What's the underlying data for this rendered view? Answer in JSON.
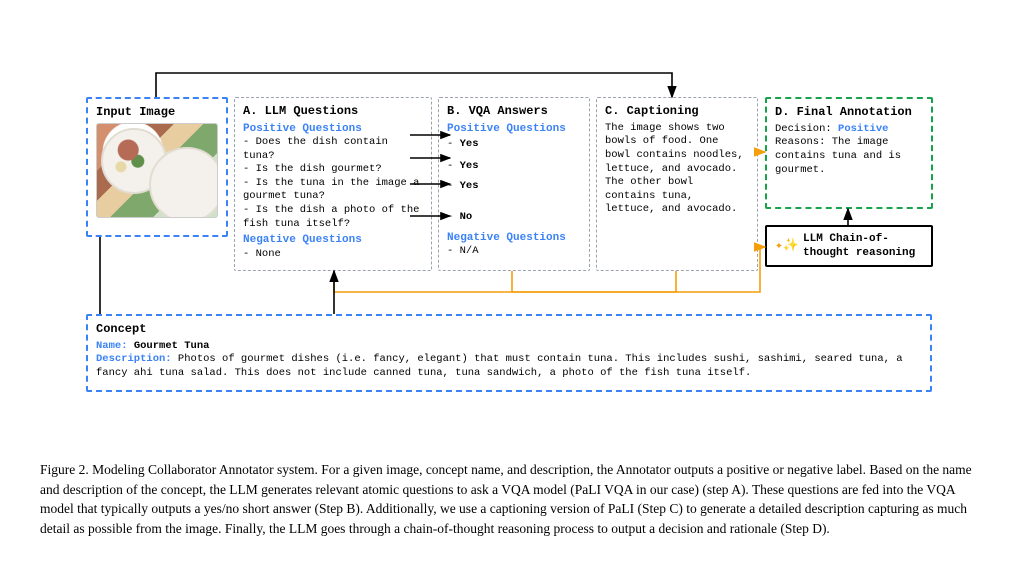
{
  "input": {
    "title": "Input Image"
  },
  "panelA": {
    "title": "A. LLM Questions",
    "pos_label": "Positive Questions",
    "neg_label": "Negative Questions",
    "questions": [
      "Does the dish contain tuna?",
      "Is the dish gourmet?",
      "Is the tuna in the image a gourmet tuna?",
      "Is the dish a photo of the fish tuna itself?"
    ],
    "neg_none": "None"
  },
  "panelB": {
    "title": "B. VQA Answers",
    "pos_label": "Positive Questions",
    "neg_label": "Negative Questions",
    "answers": [
      "Yes",
      "Yes",
      "Yes",
      "No"
    ],
    "neg_na": "N/A"
  },
  "panelC": {
    "title": "C. Captioning",
    "text": "The image shows two bowls of food. One bowl contains noodles, lettuce, and avocado. The other bowl contains tuna, lettuce, and avocado."
  },
  "panelD": {
    "title": "D. Final Annotation",
    "decision_label": "Decision: ",
    "decision_value": "Positive",
    "reasons_label": "Reasons: ",
    "reasons_text": "The image contains tuna and is gourmet."
  },
  "chain": {
    "text": "LLM Chain-of-thought reasoning"
  },
  "concept": {
    "title": "Concept",
    "name_label": "Name: ",
    "name_value": "Gourmet Tuna",
    "desc_label": "Description: ",
    "desc_text": "Photos of gourmet dishes (i.e. fancy, elegant) that must contain tuna. This includes sushi, sashimi, seared tuna, a fancy ahi tuna salad. This does not include canned tuna, tuna sandwich, a photo of the fish tuna itself."
  },
  "caption": {
    "text": "Figure 2. Modeling Collaborator Annotator system. For a given image, concept name, and description, the Annotator outputs a positive or negative label. Based on the name and description of the concept, the LLM generates relevant atomic questions to ask a VQA model (PaLI VQA in our case) (step A). These questions are fed into the VQA model that typically outputs a yes/no short answer (Step B). Additionally, we use a captioning version of PaLI (Step C) to generate a detailed description capturing as much detail as possible from the image. Finally, the LLM goes through a chain-of-thought reasoning process to output a decision and rationale (Step D)."
  }
}
